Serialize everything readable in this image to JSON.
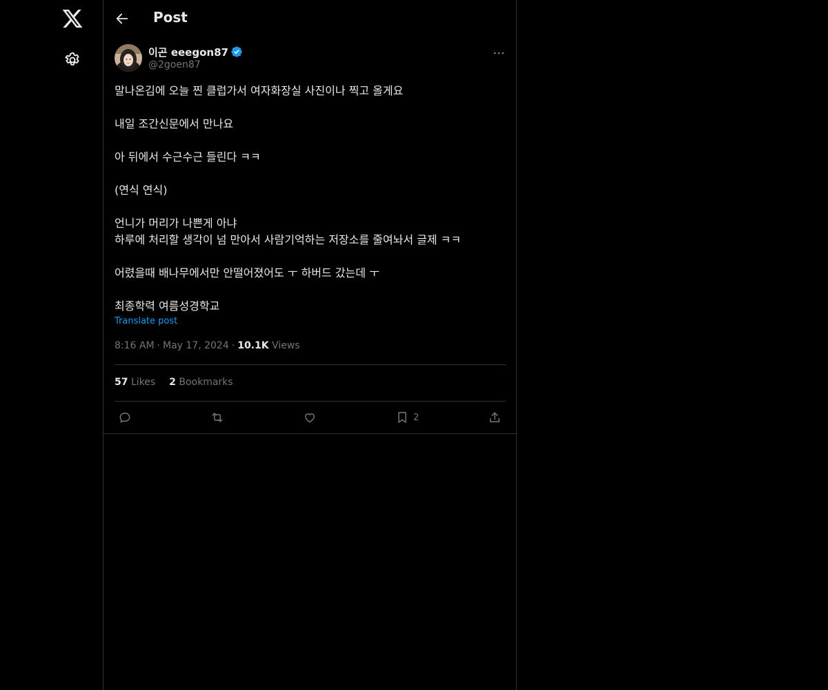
{
  "header": {
    "title": "Post"
  },
  "post": {
    "author_name": "이곤 eeegon87",
    "author_handle": "@2goen87",
    "verified": true,
    "body_paragraphs": [
      [
        "말나온김에 오늘 찐 클럽가서 여자화장실 사진이나 찍고 올게요"
      ],
      [
        "내일 조간신문에서 만나요"
      ],
      [
        "아 뒤에서 수근수근 들린다 ㅋㅋ"
      ],
      [
        "(연식 연식)"
      ],
      [
        "언니가 머리가 나쁜게 아냐",
        "하루에 처리할 생각이 넘 만아서 사람기억하는 저장소를 줄여놔서 글제 ㅋㅋ"
      ],
      [
        "어렸을때 배나무에서만 안떨어졌어도 ㅜ 하버드 갔는데 ㅜ"
      ],
      [
        "최종학력 여름성경학교"
      ]
    ],
    "translate_label": "Translate post",
    "time": "8:16 AM",
    "date": "May 17, 2024",
    "views_count": "10.1K",
    "views_label": "Views",
    "likes_count": "57",
    "likes_label": "Likes",
    "bookmarks_count": "2",
    "bookmarks_label": "Bookmarks",
    "action_bookmark_count": "2"
  },
  "colors": {
    "background": "#000000",
    "text": "#e7e9ea",
    "muted": "#71767b",
    "accent": "#1d9bf0",
    "border": "#2f3336"
  },
  "icons": {
    "logo": "x-logo-icon",
    "settings": "gear-icon",
    "back": "arrow-left-icon",
    "more": "more-horizontal-icon",
    "reply": "reply-icon",
    "repost": "repost-icon",
    "like": "heart-icon",
    "bookmark": "bookmark-icon",
    "share": "share-icon"
  }
}
